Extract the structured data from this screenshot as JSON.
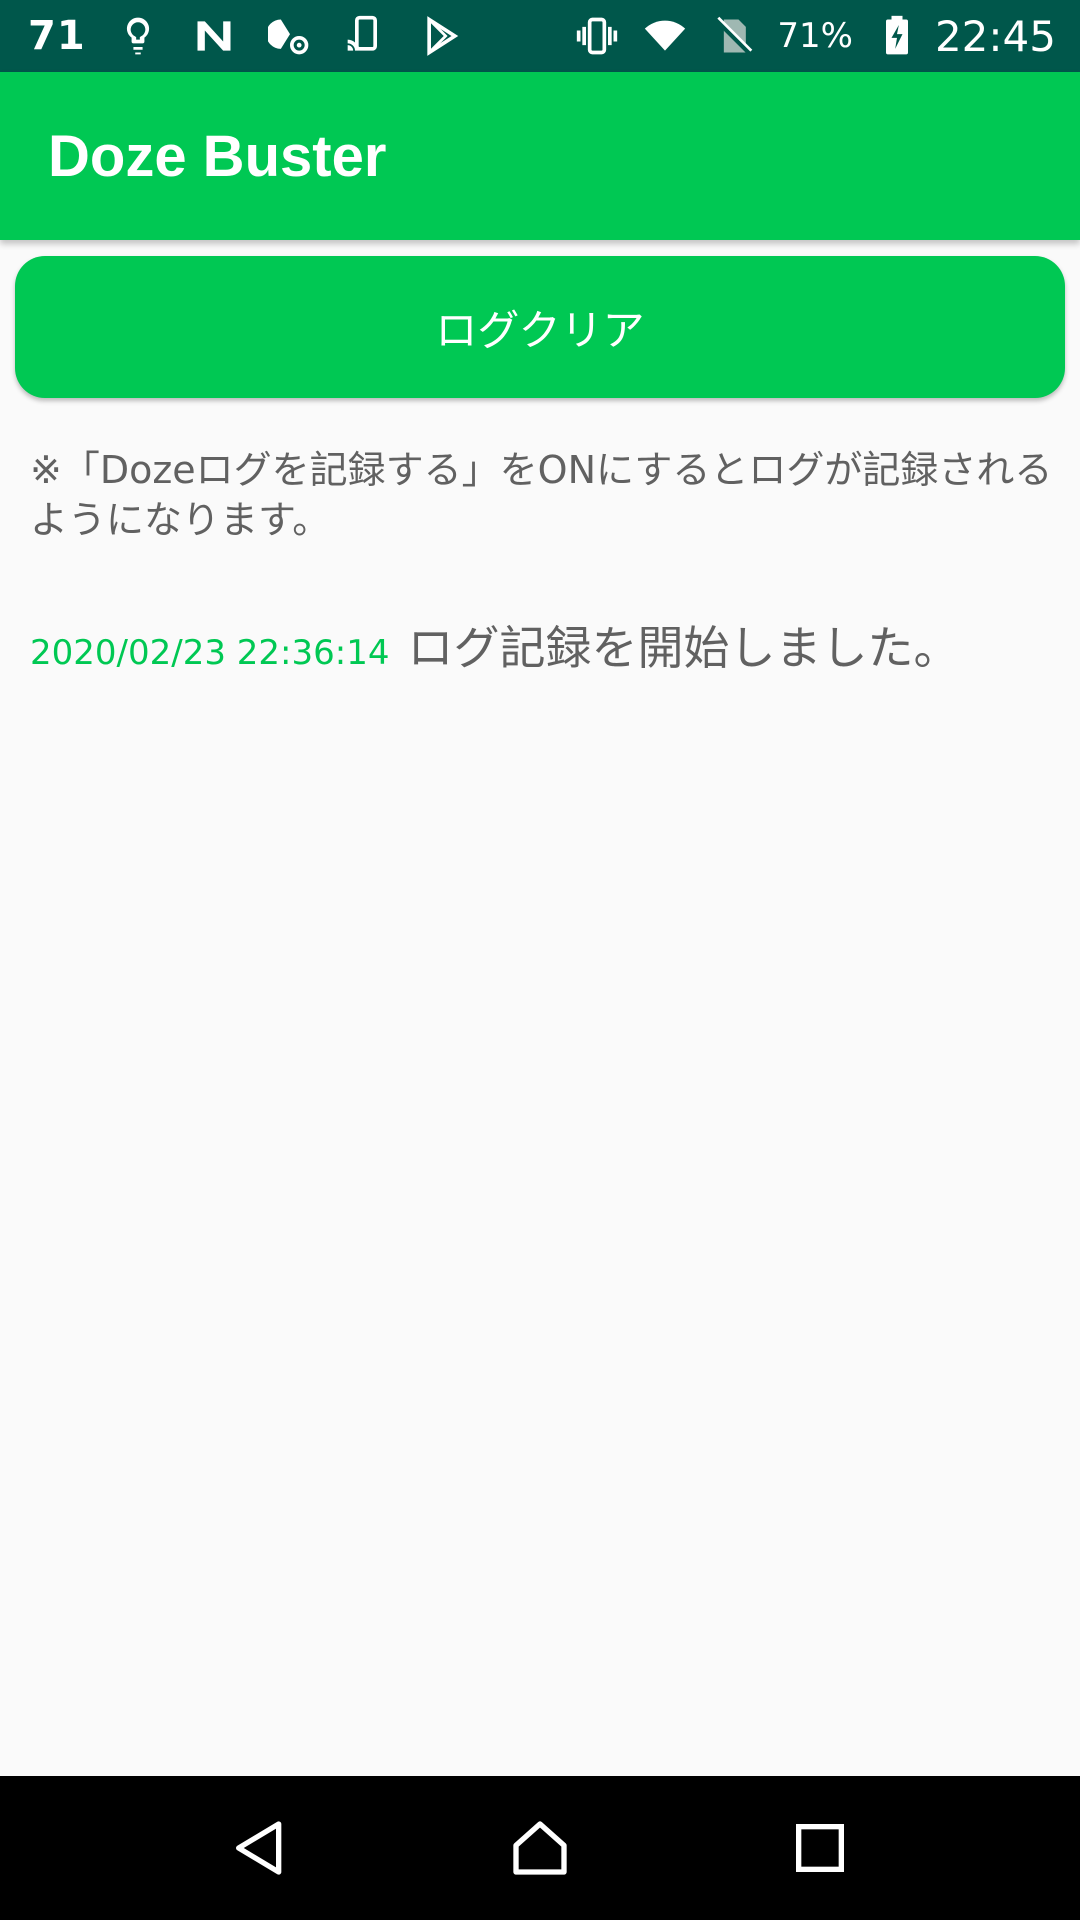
{
  "status_bar": {
    "notification_count": "71",
    "battery_percent": "71%",
    "time": "22:45",
    "left_icons": [
      "lightbulb-icon",
      "n-logo-icon",
      "settings-gear-icon",
      "cast-icon",
      "play-store-icon"
    ],
    "right_icons": [
      "vibrate-icon",
      "wifi-icon",
      "no-sim-icon",
      "battery-charging-icon"
    ],
    "background": "#00574b"
  },
  "app_bar": {
    "title": "Doze Buster",
    "color": "#00c853"
  },
  "main": {
    "clear_button_label": "ログクリア",
    "note_text": "※「Dozeログを記録する」をONにするとログが記録されるようになります。",
    "log_entries": [
      {
        "timestamp": "2020/02/23 22:36:14",
        "message": "ログ記録を開始しました。"
      }
    ]
  },
  "nav_bar": {
    "buttons": [
      "back",
      "home",
      "recents"
    ]
  }
}
